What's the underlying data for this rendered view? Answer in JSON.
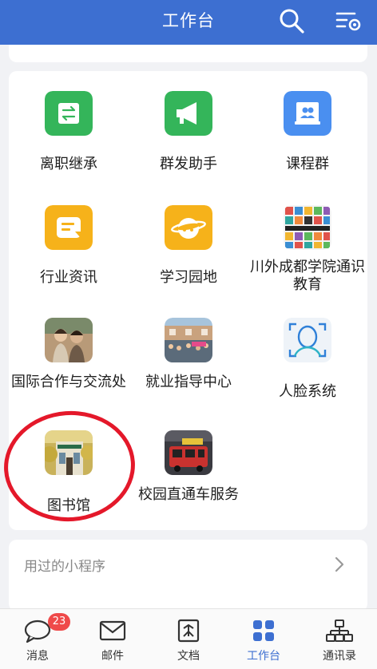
{
  "header": {
    "title": "工作台",
    "search_icon": "search-icon",
    "settings_icon": "filter-settings-icon",
    "color": "#3d6fd1"
  },
  "apps": [
    {
      "label": "离职继承",
      "icon": "transfer-icon",
      "color": "#34b55a"
    },
    {
      "label": "群发助手",
      "icon": "megaphone-icon",
      "color": "#34b55a"
    },
    {
      "label": "课程群",
      "icon": "course-group-icon",
      "color": "#4a8ff0"
    },
    {
      "label": "行业资讯",
      "icon": "news-icon",
      "color": "#f6b21a"
    },
    {
      "label": "学习园地",
      "icon": "planet-icon",
      "color": "#f6b21a"
    },
    {
      "label": "川外成都学院通识教育",
      "icon": "education-mosaic-icon"
    },
    {
      "label": "国际合作与交流处",
      "icon": "students-photo-icon"
    },
    {
      "label": "就业指导中心",
      "icon": "campus-crowd-photo-icon"
    },
    {
      "label": "人脸系统",
      "icon": "face-scan-icon"
    },
    {
      "label": "图书馆",
      "icon": "library-photo-icon"
    },
    {
      "label": "校园直通车服务",
      "icon": "bus-photo-icon"
    }
  ],
  "annotation": {
    "color": "#e4182a"
  },
  "mini_programs": {
    "label": "用过的小程序"
  },
  "tabs": [
    {
      "label": "消息",
      "icon": "message-icon",
      "badge": "23"
    },
    {
      "label": "邮件",
      "icon": "mail-icon"
    },
    {
      "label": "文档",
      "icon": "document-icon"
    },
    {
      "label": "工作台",
      "icon": "workbench-icon",
      "active": true
    },
    {
      "label": "通讯录",
      "icon": "contacts-icon"
    }
  ]
}
